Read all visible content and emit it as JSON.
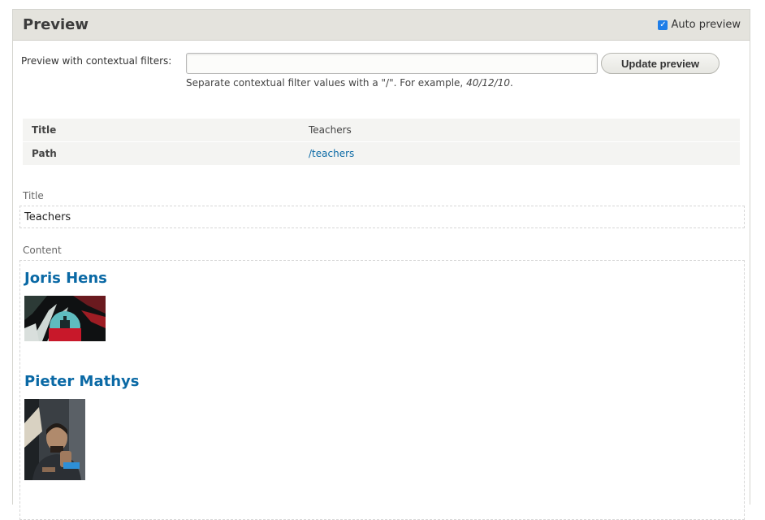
{
  "panel": {
    "title": "Preview",
    "auto_preview_label": "Auto preview",
    "auto_preview_checked": true
  },
  "filters": {
    "label": "Preview with contextual filters:",
    "input_value": "",
    "button_label": "Update preview",
    "help_prefix": "Separate contextual filter values with a \"/\". For example, ",
    "help_example": "40/12/10",
    "help_suffix": "."
  },
  "info": {
    "rows": [
      {
        "key": "Title",
        "value": "Teachers"
      },
      {
        "key": "Path",
        "value": "/teachers"
      }
    ]
  },
  "title_section": {
    "label": "Title",
    "value": "Teachers"
  },
  "content_section": {
    "label": "Content",
    "teachers": [
      {
        "name": "Joris Hens",
        "image_icon": "abstract-art-thumbnail"
      },
      {
        "name": "Pieter Mathys",
        "image_icon": "portrait-photo-thumbnail"
      }
    ]
  },
  "colors": {
    "link": "#0a69a5",
    "header_bg": "#e4e3dd",
    "checkbox": "#1f7ee8"
  }
}
